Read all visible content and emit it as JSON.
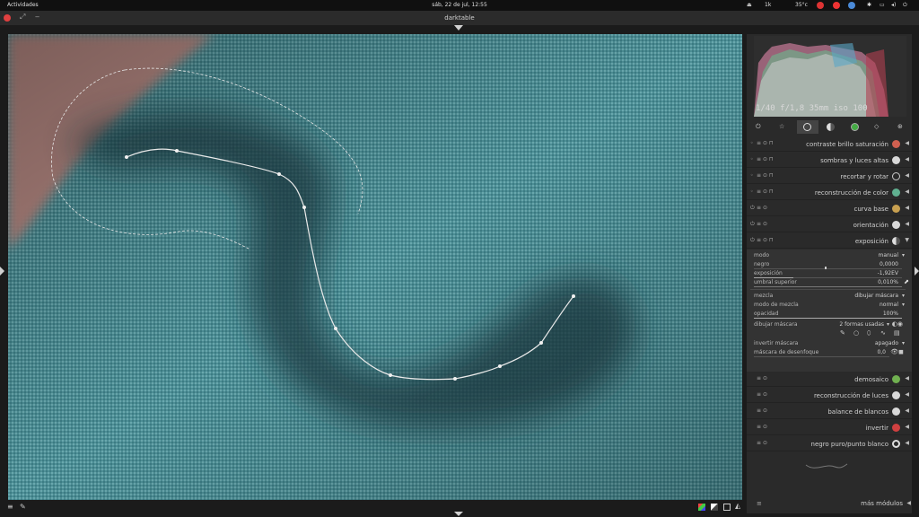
{
  "topbar": {
    "activities": "Actividades",
    "datetime": "sáb, 22 de jul, 12:55",
    "temp": "35°c",
    "net": "1k"
  },
  "window": {
    "title": "darktable"
  },
  "histogram": {
    "exif": "1/40 f/1,8 35mm iso 100"
  },
  "modules": [
    {
      "label": "contraste brillo saturación",
      "color": "#d06050"
    },
    {
      "label": "sombras y luces altas",
      "color": "#d8d8d8"
    },
    {
      "label": "recortar y rotar",
      "color": "#d8d8d8"
    },
    {
      "label": "reconstrucción de color",
      "color": "#60b090"
    },
    {
      "label": "curva base",
      "color": "#c8a050"
    },
    {
      "label": "orientación",
      "color": "#d8d8d8"
    },
    {
      "label": "exposición",
      "color": "#d8d8d8"
    },
    {
      "label": "demosaico",
      "color": "#70b050"
    },
    {
      "label": "reconstrucción de luces",
      "color": "#d8d8d8"
    },
    {
      "label": "balance de blancos",
      "color": "#d8d8d8"
    },
    {
      "label": "invertir",
      "color": "#d04040"
    },
    {
      "label": "negro puro/punto blanco",
      "color": "#d8d8d8"
    }
  ],
  "exposure": {
    "modo_label": "modo",
    "modo_value": "manual",
    "negro_label": "negro",
    "negro_value": "0,0000",
    "exposicion_label": "exposición",
    "exposicion_value": "-1,92EV",
    "umbral_label": "umbral superior",
    "umbral_value": "0,010%",
    "mezcla_label": "mezcla",
    "mezcla_value": "dibujar máscara",
    "modo_mezcla_label": "modo de mezcla",
    "modo_mezcla_value": "normal",
    "opacidad_label": "opacidad",
    "opacidad_value": "100%",
    "dibujar_label": "dibujar máscara",
    "dibujar_value": "2 formas usadas",
    "invertir_label": "invertir máscara",
    "invertir_value": "apagado",
    "desenfoque_label": "máscara de desenfoque",
    "desenfoque_value": "0,0"
  },
  "more_modules": "más módulos"
}
